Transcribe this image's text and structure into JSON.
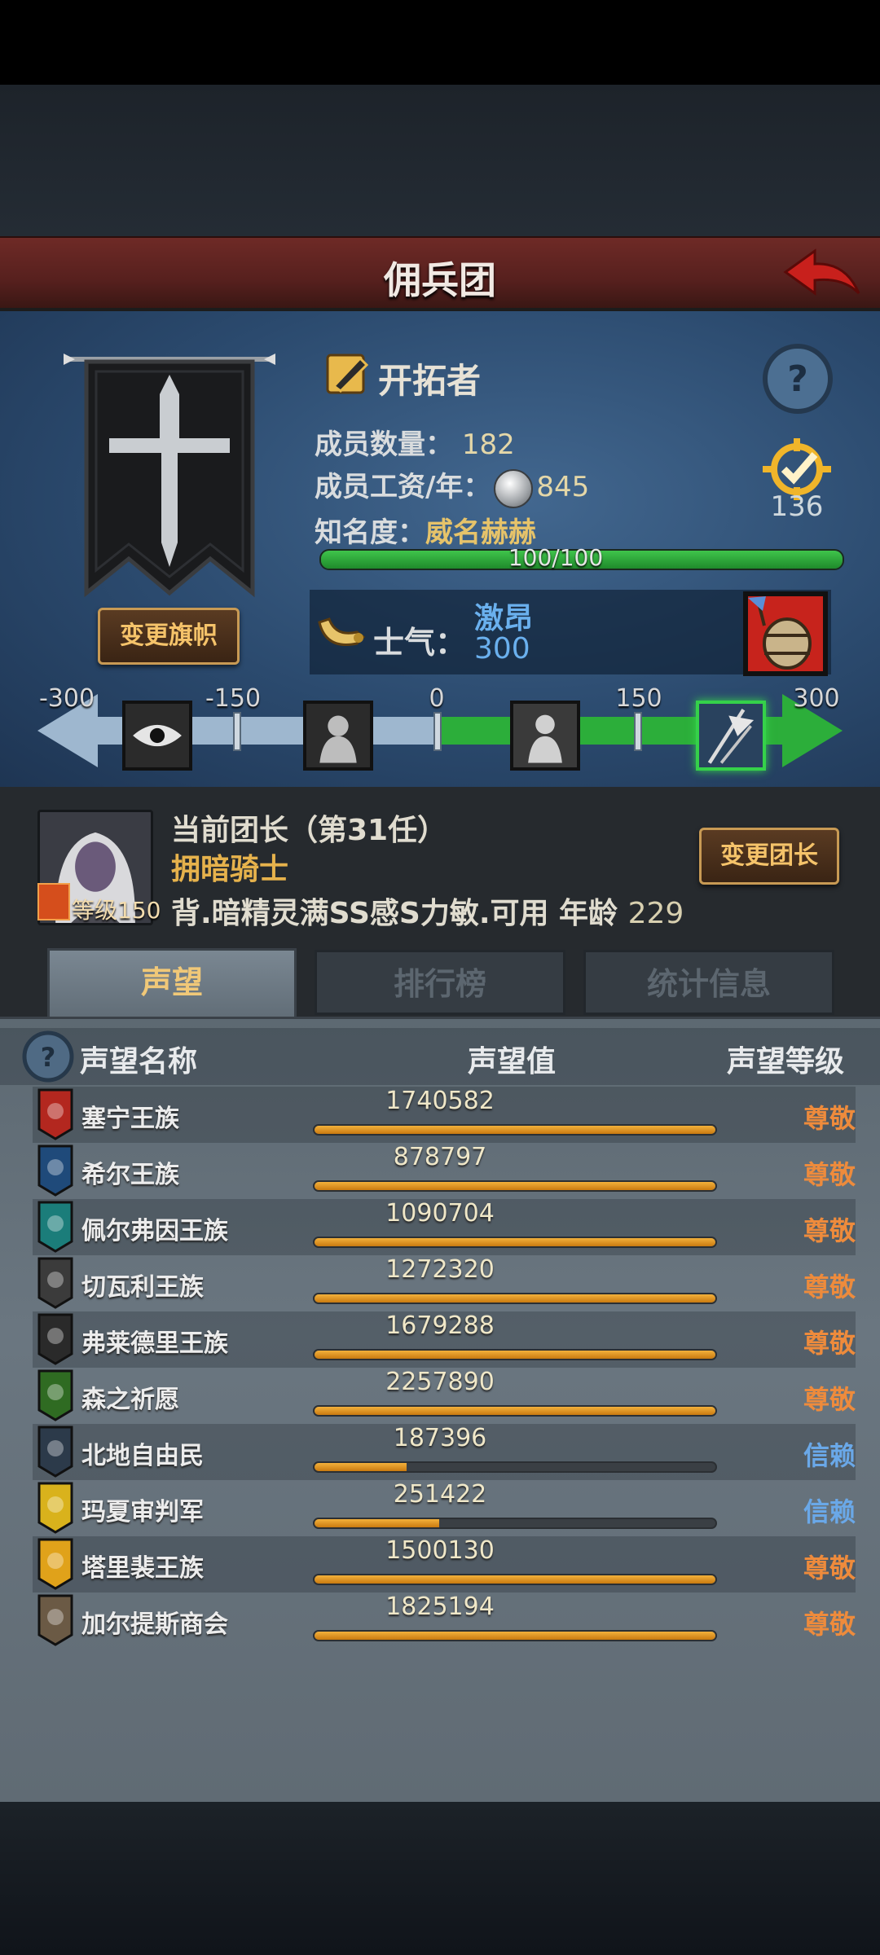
{
  "header": {
    "title": "佣兵团"
  },
  "group": {
    "title": "开拓者",
    "change_flag_label": "变更旗帜",
    "members_label": "成员数量：",
    "members_value": "182",
    "wage_label": "成员工资/年：",
    "wage_value": "845",
    "fame_label": "知名度：",
    "fame_value": "威名赫赫",
    "fame_progress": "100/100",
    "fame_fraction": 1.0,
    "target_value": "136",
    "morale_label": "士气：",
    "morale_state": "激昂",
    "morale_value": "300"
  },
  "morale_scale": {
    "ticks": [
      "-300",
      "-150",
      "0",
      "150",
      "300"
    ],
    "current": 300
  },
  "leader": {
    "title": "当前团长（第31任）",
    "class": "拥暗骑士",
    "level_label": "等级150",
    "description": "背.暗精灵满SS感S力敏.可用",
    "age_label": "年龄",
    "age_value": "229",
    "change_leader_label": "变更团长"
  },
  "tabs": [
    {
      "label": "声望"
    },
    {
      "label": "排行榜"
    },
    {
      "label": "统计信息"
    }
  ],
  "table": {
    "headers": {
      "name": "声望名称",
      "value": "声望值",
      "level": "声望等级"
    },
    "rows": [
      {
        "name": "塞宁王族",
        "value": "1740582",
        "level": "尊敬",
        "fill": 1.0,
        "color": "#b3271f"
      },
      {
        "name": "希尔王族",
        "value": "878797",
        "level": "尊敬",
        "fill": 1.0,
        "color": "#1f4a7a"
      },
      {
        "name": "佩尔弗因王族",
        "value": "1090704",
        "level": "尊敬",
        "fill": 1.0,
        "color": "#1b7d7a"
      },
      {
        "name": "切瓦利王族",
        "value": "1272320",
        "level": "尊敬",
        "fill": 1.0,
        "color": "#3b3b3b"
      },
      {
        "name": "弗莱德里王族",
        "value": "1679288",
        "level": "尊敬",
        "fill": 1.0,
        "color": "#2a2a2a"
      },
      {
        "name": "森之祈愿",
        "value": "2257890",
        "level": "尊敬",
        "fill": 1.0,
        "color": "#2f6b22"
      },
      {
        "name": "北地自由民",
        "value": "187396",
        "level": "信赖",
        "fill": 0.23,
        "color": "#2c3a4a"
      },
      {
        "name": "玛夏审判军",
        "value": "251422",
        "level": "信赖",
        "fill": 0.31,
        "color": "#d9b21c"
      },
      {
        "name": "塔里裴王族",
        "value": "1500130",
        "level": "尊敬",
        "fill": 1.0,
        "color": "#e0a21a"
      },
      {
        "name": "加尔提斯商会",
        "value": "1825194",
        "level": "尊敬",
        "fill": 1.0,
        "color": "#6b5a45"
      }
    ]
  },
  "colors": {
    "level_respect": "#ee8b3c",
    "level_trust": "#6aa8e8"
  }
}
